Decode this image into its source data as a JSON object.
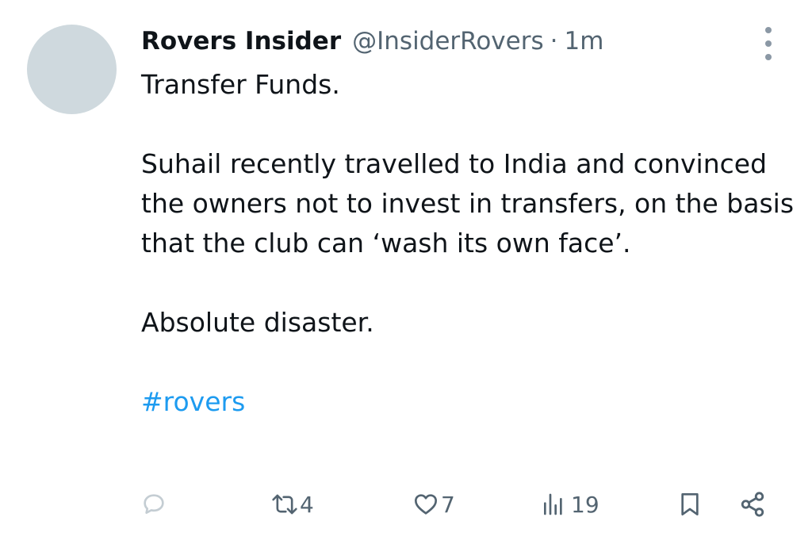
{
  "tweet": {
    "display_name": "Rovers Insider",
    "handle": "@InsiderRovers",
    "separator": "·",
    "time": "1m",
    "paragraphs": [
      "Transfer Funds.",
      "Suhail recently travelled to India and convinced the owners not to invest in transfers, on the basis that the club can ‘wash its own face’.",
      "Absolute disaster."
    ],
    "hashtag": "#rovers"
  },
  "actions": {
    "reply_count": "",
    "retweet_count": "4",
    "like_count": "7",
    "views_count": "19"
  },
  "icons": {
    "more": "more-vertical-icon",
    "reply": "reply-icon",
    "retweet": "retweet-icon",
    "like": "heart-icon",
    "views": "views-icon",
    "bookmark": "bookmark-icon",
    "share": "share-icon"
  },
  "colors": {
    "text": "#0f1419",
    "muted": "#536471",
    "link": "#1d9bf0",
    "avatar": "#cfd9de"
  }
}
